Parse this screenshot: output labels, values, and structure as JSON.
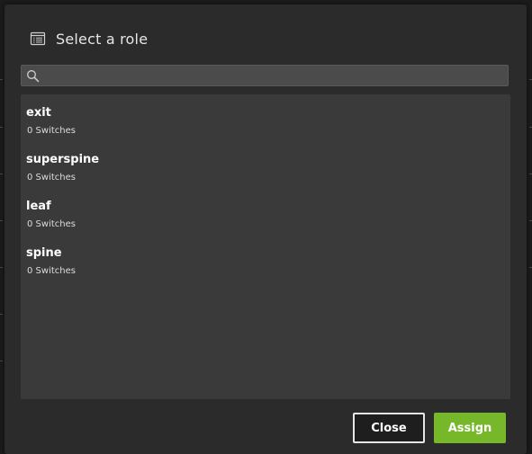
{
  "dialog": {
    "title": "Select a role",
    "icon": "list-icon"
  },
  "search": {
    "value": "",
    "placeholder": "",
    "icon": "search-icon"
  },
  "roles": [
    {
      "name": "exit",
      "count": "0 Switches"
    },
    {
      "name": "superspine",
      "count": "0 Switches"
    },
    {
      "name": "leaf",
      "count": "0 Switches"
    },
    {
      "name": "spine",
      "count": "0 Switches"
    }
  ],
  "buttons": {
    "close_label": "Close",
    "assign_label": "Assign"
  },
  "colors": {
    "accent": "#76b82a",
    "dialog_bg": "#2b2b2b",
    "list_bg": "#3a3a3a"
  }
}
